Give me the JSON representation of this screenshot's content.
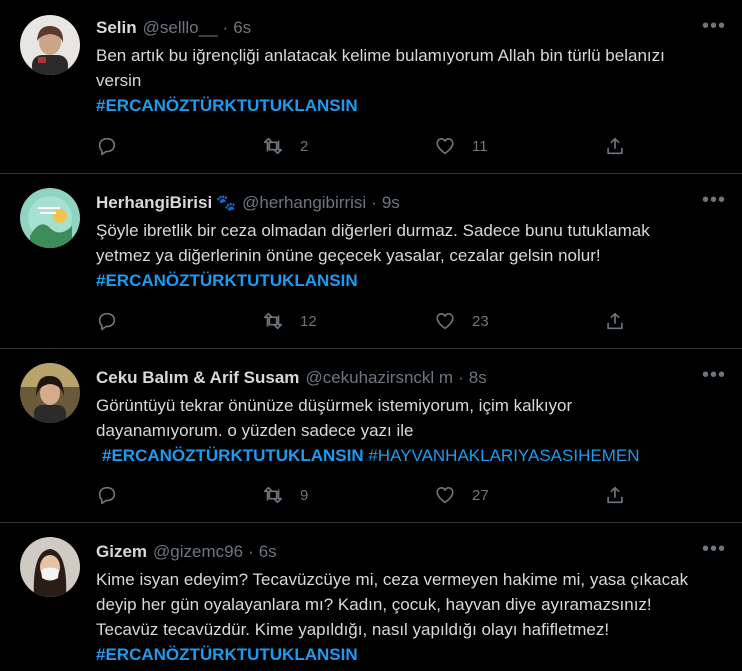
{
  "tweets": [
    {
      "name": "Selin",
      "badge": "",
      "handle": "@selllo__",
      "time": "6s",
      "lines": [
        "Ben artık bu iğrençliği anlatacak kelime bulamıyorum Allah bin türlü belanızı",
        "versin"
      ],
      "hashtags": [
        "#ERCANÖZTÜRKTUTUKLANSIN"
      ],
      "replies": "",
      "retweets": "2",
      "likes": "11"
    },
    {
      "name": "HerhangiBirisi",
      "badge": "🐾",
      "handle": "@herhangibirrisi",
      "time": "9s",
      "lines": [
        "Şöyle ibretlik bir ceza olmadan diğerleri durmaz. Sadece bunu tutuklamak",
        "yetmez ya diğerlerinin önüne geçecek yasalar, cezalar gelsin nolur!"
      ],
      "hashtags": [
        "#ERCANÖZTÜRKTUTUKLANSIN"
      ],
      "replies": "",
      "retweets": "12",
      "likes": "23"
    },
    {
      "name": "Ceku Balım & Arif Susam",
      "badge": "",
      "handle": "@cekuhazirsnckl m",
      "time": "8s",
      "lines": [
        "Görüntüyü tekrar önünüze düşürmek istemiyorum, içim kalkıyor",
        "dayanamıyorum. o yüzden sadece yazı ile"
      ],
      "hashtags": [
        "#ERCANÖZTÜRKTUTUKLANSIN",
        "#HAYVANHAKLARIYASASIHEMEN"
      ],
      "replies": "",
      "retweets": "9",
      "likes": "27"
    },
    {
      "name": "Gizem",
      "badge": "",
      "handle": "@gizemc96",
      "time": "6s",
      "lines": [
        "Kime isyan edeyim? Tecavüzcüye mi, ceza vermeyen hakime mi, yasa çıkacak",
        "deyip her gün oyalayanlara mı? Kadın, çocuk, hayvan diye ayıramazsınız!",
        "Tecavüz tecavüzdür. Kime yapıldığı, nasıl yapıldığı olayı hafifletmez!"
      ],
      "hashtags": [
        "#ERCANÖZTÜRKTUTUKLANSIN"
      ]
    }
  ],
  "ui": {
    "more_glyph": "•••",
    "dot": "·"
  },
  "colors": {
    "background": "#000000",
    "text": "#d9d9d9",
    "muted": "#6e767d",
    "link": "#1d9bf0",
    "divider": "#2f3336"
  },
  "icons": [
    "reply-icon",
    "retweet-icon",
    "like-icon",
    "share-icon",
    "more-icon"
  ]
}
